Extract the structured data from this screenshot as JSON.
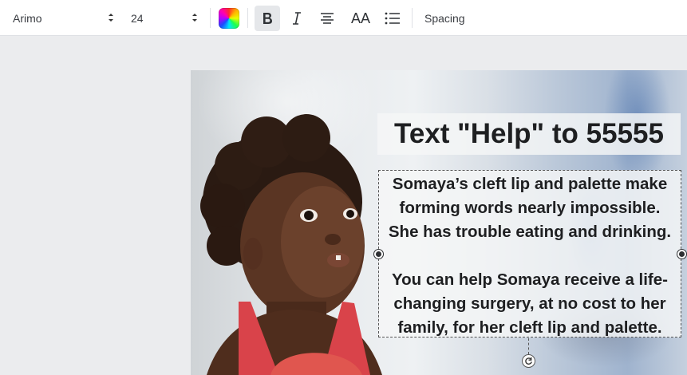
{
  "toolbar": {
    "font_family": "Arimo",
    "font_size": "24",
    "spacing_label": "Spacing",
    "case_label": "AA",
    "icons": {
      "color": "color-palette-icon",
      "bold": "bold-icon",
      "italic": "italic-icon",
      "align": "align-center-icon",
      "list": "bullet-list-icon",
      "rotate": "rotate-icon"
    }
  },
  "canvas": {
    "headline": "Text \"Help\" to 55555",
    "body_lines_p1": [
      "Somaya’s cleft lip and palette make",
      "forming words nearly impossible.",
      "She has trouble eating and drinking."
    ],
    "body_lines_p2": [
      "You can help Somaya receive a life-",
      "changing surgery, at no cost to her",
      "family, for her cleft lip and palette."
    ]
  },
  "colors": {
    "canvas_bg": "#ebecee",
    "text": "#1e1f21",
    "active_button": "#e5e7ea"
  }
}
